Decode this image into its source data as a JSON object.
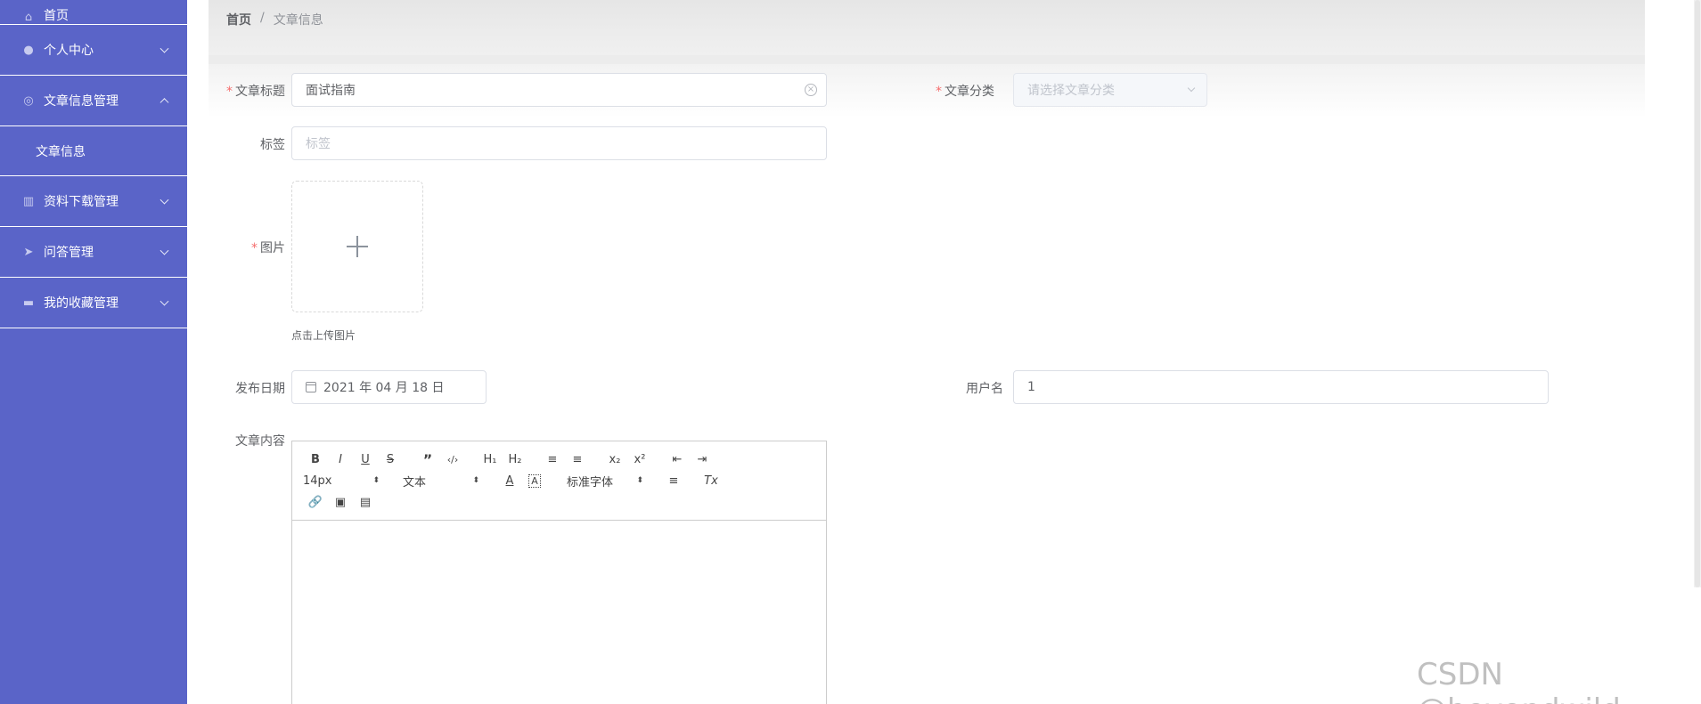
{
  "sidebar": {
    "items": [
      {
        "label": "首页"
      },
      {
        "label": "个人中心"
      },
      {
        "label": "文章信息管理"
      },
      {
        "label": "文章信息"
      },
      {
        "label": "资料下载管理"
      },
      {
        "label": "问答管理"
      },
      {
        "label": "我的收藏管理"
      }
    ]
  },
  "breadcrumb": {
    "home": "首页",
    "separator": "/",
    "current": "文章信息"
  },
  "form": {
    "title": {
      "label": "文章标题",
      "value": "面试指南"
    },
    "category": {
      "label": "文章分类",
      "placeholder": "请选择文章分类"
    },
    "tags": {
      "label": "标签",
      "placeholder": "标签"
    },
    "image": {
      "label": "图片",
      "hint": "点击上传图片"
    },
    "date": {
      "label": "发布日期",
      "value": "2021 年 04 月 18 日"
    },
    "username": {
      "label": "用户名",
      "value": "1"
    },
    "content": {
      "label": "文章内容"
    },
    "required_mark": "*"
  },
  "editor": {
    "row1": [
      "B",
      "I",
      "U",
      "S",
      "”",
      "‹/›",
      "H₁",
      "H₂",
      "≡",
      "≡",
      "x₂",
      "x²",
      "⇤",
      "⇥"
    ],
    "font_size": "14px",
    "header_select": "文本",
    "font_family": "标准字体",
    "color_btn": "A",
    "bg_btn": "A",
    "align_btn": "≡",
    "clear_btn": "Tx",
    "row3": [
      "🔗",
      "▣",
      "▤"
    ]
  },
  "watermark": "CSDN @beyondwild"
}
